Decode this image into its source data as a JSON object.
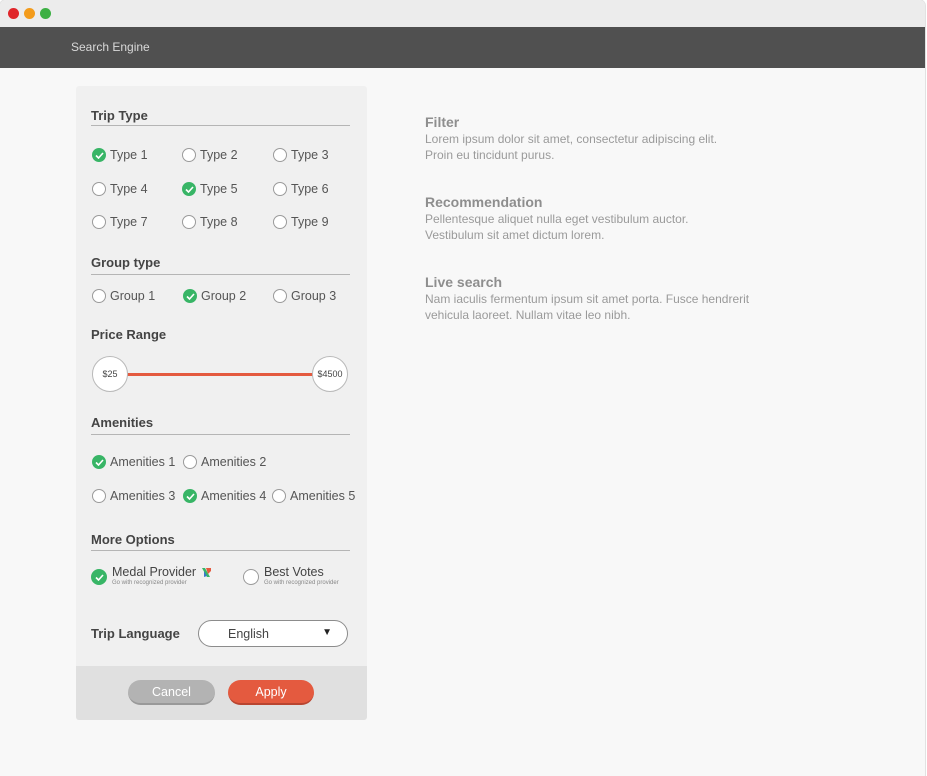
{
  "window": {
    "controls": [
      {
        "name": "close",
        "color": "#e0262a"
      },
      {
        "name": "minimize",
        "color": "#f39b1b"
      },
      {
        "name": "zoom",
        "color": "#3cb043"
      }
    ]
  },
  "app": {
    "title": "Search Engine"
  },
  "panel": {
    "trip_type": {
      "title": "Trip Type",
      "options": [
        {
          "label": "Type 1",
          "checked": true
        },
        {
          "label": "Type 2",
          "checked": false
        },
        {
          "label": "Type 3",
          "checked": false
        },
        {
          "label": "Type 4",
          "checked": false
        },
        {
          "label": "Type 5",
          "checked": true
        },
        {
          "label": "Type 6",
          "checked": false
        },
        {
          "label": "Type 7",
          "checked": false
        },
        {
          "label": "Type 8",
          "checked": false
        },
        {
          "label": "Type 9",
          "checked": false
        }
      ]
    },
    "group_type": {
      "title": "Group type",
      "options": [
        {
          "label": "Group 1",
          "checked": false
        },
        {
          "label": "Group 2",
          "checked": true
        },
        {
          "label": "Group 3",
          "checked": false
        }
      ]
    },
    "price_range": {
      "title": "Price Range",
      "min_label": "$25",
      "max_label": "$4500"
    },
    "amenities": {
      "title": "Amenities",
      "options": [
        {
          "label": "Amenities 1",
          "checked": true
        },
        {
          "label": "Amenities 2",
          "checked": false
        },
        {
          "label": "Amenities 3",
          "checked": false
        },
        {
          "label": "Amenities 4",
          "checked": true
        },
        {
          "label": "Amenities 5",
          "checked": false
        }
      ]
    },
    "more_options": {
      "title": "More Options",
      "options": [
        {
          "label": "Medal Provider",
          "sub": "Go with recognized provider",
          "checked": true
        },
        {
          "label": "Best Votes",
          "sub": "Go with recognized provider",
          "checked": false
        }
      ]
    },
    "trip_language": {
      "label": "Trip Language",
      "value": "English",
      "arrow": "▼"
    },
    "buttons": {
      "cancel": "Cancel",
      "apply": "Apply"
    }
  },
  "descriptions": [
    {
      "title": "Filter",
      "lines": [
        "Lorem ipsum dolor sit amet, consectetur adipiscing elit.",
        "Proin eu tincidunt purus."
      ]
    },
    {
      "title": "Recommendation",
      "lines": [
        "Pellentesque aliquet nulla eget vestibulum auctor.",
        "Vestibulum sit amet dictum lorem."
      ]
    },
    {
      "title": "Live search",
      "lines": [
        "Nam iaculis fermentum ipsum sit amet porta. Fusce hendrerit",
        "vehicula laoreet. Nullam vitae leo nibh."
      ]
    }
  ],
  "colors": {
    "accent": "#e45a3f",
    "check": "#38b566",
    "appbar": "#505050"
  }
}
